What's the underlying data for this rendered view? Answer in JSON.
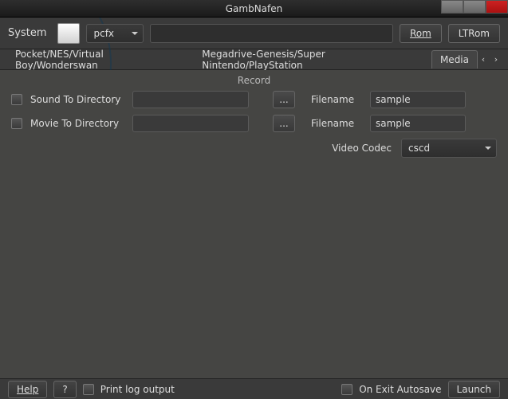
{
  "window": {
    "title": "GambNafen"
  },
  "toolbar": {
    "system_label": "System",
    "system_value": "pcfx",
    "rom_button": "Rom",
    "ltrom_button": "LTRom"
  },
  "tabs": {
    "tab1": "Pocket/NES/Virtual Boy/Wonderswan",
    "tab2": "Megadrive-Genesis/Super Nintendo/PlayStation",
    "tab3": "Media"
  },
  "record": {
    "title": "Record",
    "sound_label": "Sound To Directory",
    "movie_label": "Movie To Directory",
    "browse": "...",
    "filename_label": "Filename",
    "sound_filename": "sample",
    "movie_filename": "sample",
    "codec_label": "Video Codec",
    "codec_value": "cscd"
  },
  "footer": {
    "help": "Help",
    "qmark": "?",
    "print_log": "Print log output",
    "autosave": "On Exit Autosave",
    "launch": "Launch"
  }
}
